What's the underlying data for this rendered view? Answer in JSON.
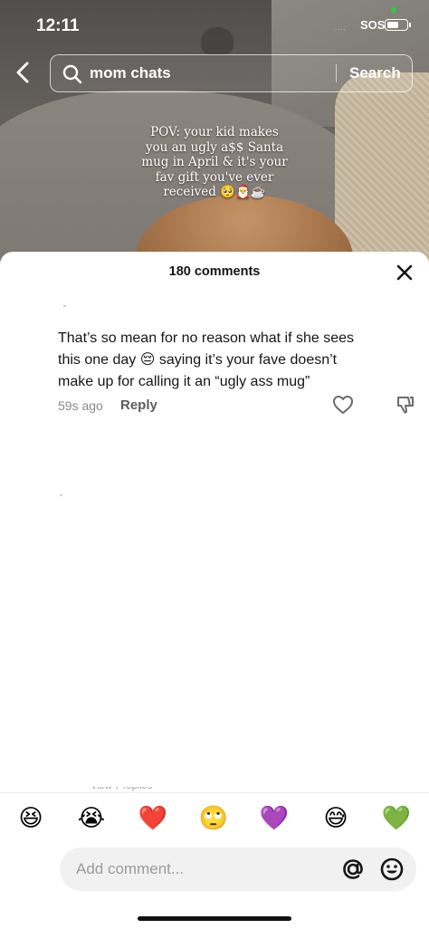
{
  "status_bar": {
    "time": "12:11",
    "carrier": "SOS"
  },
  "search": {
    "query": "mom chats",
    "button_label": "Search"
  },
  "video": {
    "caption": "POV: your kid makes\nyou an ugly a$$ Santa\nmug in April & it's your\nfav gift you've ever\nreceived 🥺🎅☕"
  },
  "comments": {
    "count_label": "180 comments",
    "items": [
      {
        "text": "That’s so mean for no reason what if she sees\nthis one day 😔 saying it’s your fave doesn’t\nmake up for calling it an “ugly ass mug”",
        "time": "59s ago",
        "reply_label": "Reply"
      }
    ]
  },
  "emoji_bar": [
    "😆",
    "😭",
    "❤️",
    "🙄",
    "💜",
    "😅",
    "💚"
  ],
  "composer": {
    "placeholder": "Add comment..."
  },
  "colors": {
    "sheet_bg": "#ffffff",
    "text_primary": "#161616",
    "text_secondary": "#8a8a8a",
    "input_bg": "#f1f1f2"
  }
}
